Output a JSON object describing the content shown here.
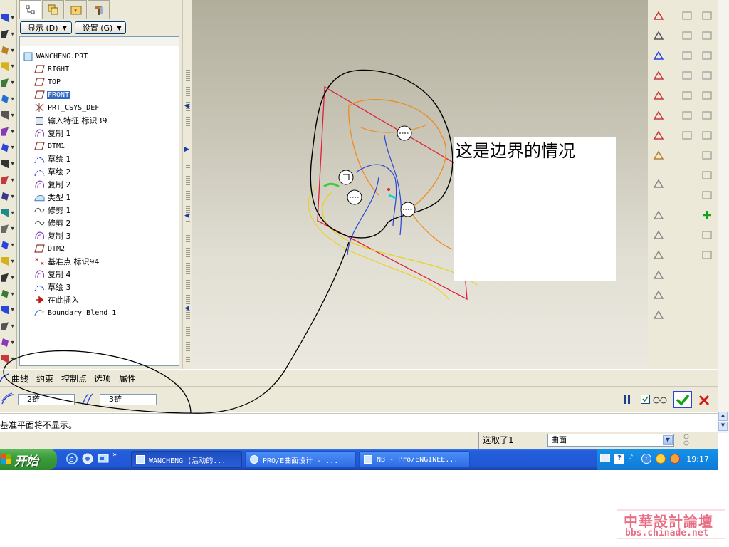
{
  "tree": {
    "menus": {
      "display": "显示 (D)",
      "settings": "设置 (G)"
    },
    "nodes": [
      {
        "label": "WANCHENG.PRT",
        "icon": "part-icon",
        "indent": 0
      },
      {
        "label": "RIGHT",
        "icon": "datum-plane-icon",
        "indent": 1
      },
      {
        "label": "TOP",
        "icon": "datum-plane-icon",
        "indent": 1
      },
      {
        "label": "FRONT",
        "icon": "datum-plane-icon",
        "indent": 1,
        "selected": true
      },
      {
        "label": "PRT_CSYS_DEF",
        "icon": "csys-icon",
        "indent": 1
      },
      {
        "label": "输入特征 标识39",
        "icon": "import-feature-icon",
        "indent": 1
      },
      {
        "label": "复制 1",
        "icon": "copy-surface-icon",
        "indent": 1
      },
      {
        "label": "DTM1",
        "icon": "datum-plane-icon",
        "indent": 1
      },
      {
        "label": "草绘 1",
        "icon": "sketch-icon",
        "indent": 1
      },
      {
        "label": "草绘 2",
        "icon": "sketch-icon",
        "indent": 1
      },
      {
        "label": "复制 2",
        "icon": "copy-surface-icon",
        "indent": 1
      },
      {
        "label": "类型 1",
        "icon": "type-feature-icon",
        "indent": 1
      },
      {
        "label": "修剪 1",
        "icon": "trim-icon",
        "indent": 1
      },
      {
        "label": "修剪 2",
        "icon": "trim-icon",
        "indent": 1
      },
      {
        "label": "复制 3",
        "icon": "copy-surface-icon",
        "indent": 1
      },
      {
        "label": "DTM2",
        "icon": "datum-plane-icon",
        "indent": 1
      },
      {
        "label": "基准点 标识94",
        "icon": "datum-point-icon",
        "indent": 1
      },
      {
        "label": "复制 4",
        "icon": "copy-surface-icon",
        "indent": 1
      },
      {
        "label": "草绘 3",
        "icon": "sketch-icon",
        "indent": 1
      },
      {
        "label": "在此插入",
        "icon": "insert-here-arrow-icon",
        "indent": 1
      },
      {
        "label": "Boundary Blend 1",
        "icon": "boundary-blend-icon",
        "indent": 1
      }
    ]
  },
  "graphics": {
    "annotation": "这是边界的情况"
  },
  "dashboard": {
    "tabs": [
      "曲线",
      "约束",
      "控制点",
      "选项",
      "属性"
    ],
    "chain1": "2链",
    "chain2": "3链"
  },
  "message": "基准平面将不显示。",
  "status": {
    "selected": "选取了1",
    "filter": "曲面"
  },
  "taskbar": {
    "start": "开始",
    "windows": [
      "WANCHENG (活动的...",
      "PRO/E曲面设计 - ...",
      "NB - Pro/ENGINEE..."
    ],
    "clock": "19:17"
  },
  "watermark": {
    "title": "中華設計論壇",
    "url": "bbs.chinade.net"
  },
  "colors": {
    "accent": "#316ac5",
    "datum_plane": "#e0203a",
    "curve_orange": "#f08a1c",
    "curve_yellow": "#e8d21c",
    "curve_blue": "#2a45d8",
    "taskbar": "#245edb",
    "watermark": "#e86e84"
  }
}
